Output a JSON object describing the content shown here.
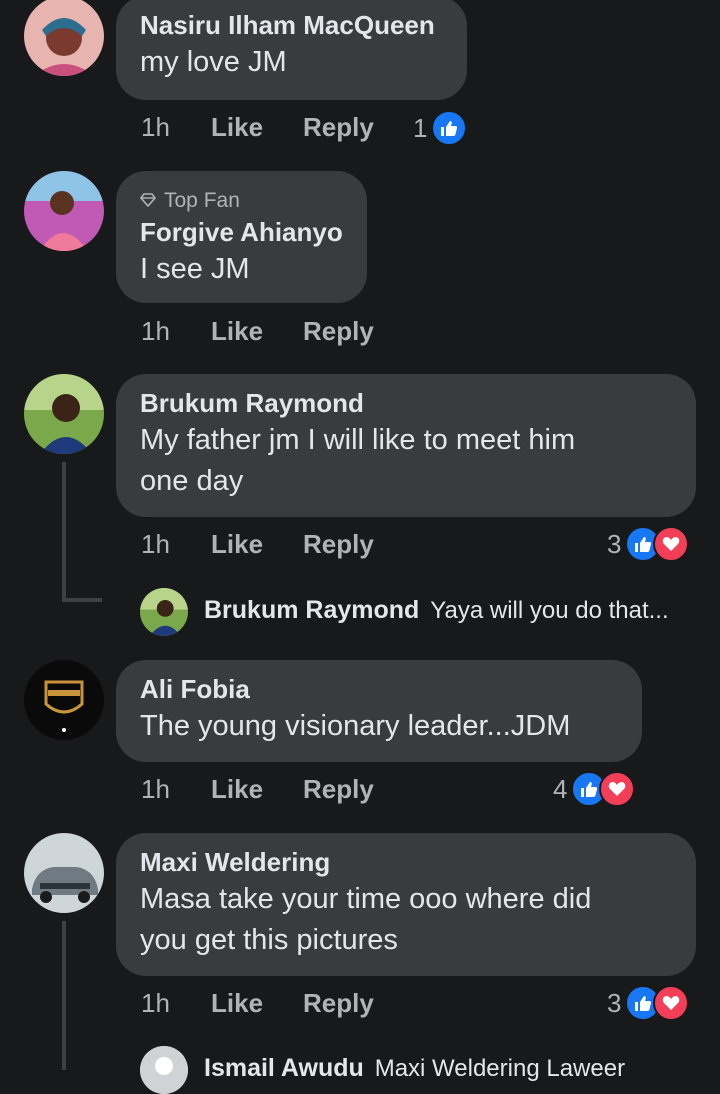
{
  "comments": [
    {
      "name": "Nasiru Ilham MacQueen",
      "text": "my love JM",
      "time": "1h",
      "like": "Like",
      "reply": "Reply",
      "reactions": "1"
    },
    {
      "badge": "Top Fan",
      "name": "Forgive Ahianyo",
      "text": "I see JM",
      "time": "1h",
      "like": "Like",
      "reply": "Reply"
    },
    {
      "name": "Brukum Raymond",
      "text_line1": "My father jm I will like to meet him",
      "text_line2": "one day",
      "time": "1h",
      "like": "Like",
      "reply": "Reply",
      "reactions": "3",
      "reply_preview": {
        "name": "Brukum Raymond",
        "text": "Yaya will you do that..."
      }
    },
    {
      "name": "Ali Fobia",
      "text": "The young visionary leader...JDM",
      "time": "1h",
      "like": "Like",
      "reply": "Reply",
      "reactions": "4"
    },
    {
      "name": "Maxi Weldering",
      "text_line1": "Masa take your time ooo where did",
      "text_line2": "you get this pictures",
      "time": "1h",
      "like": "Like",
      "reply": "Reply",
      "reactions": "3",
      "reply_preview": {
        "name": "Ismail Awudu",
        "text": "Maxi Weldering Laweer"
      }
    }
  ],
  "colors": {
    "background": "#18191a",
    "bubble": "#3a3b3c",
    "like": "#1877f2",
    "love": "#f33e58"
  },
  "icons": [
    "like-icon",
    "love-icon",
    "diamond-icon"
  ]
}
